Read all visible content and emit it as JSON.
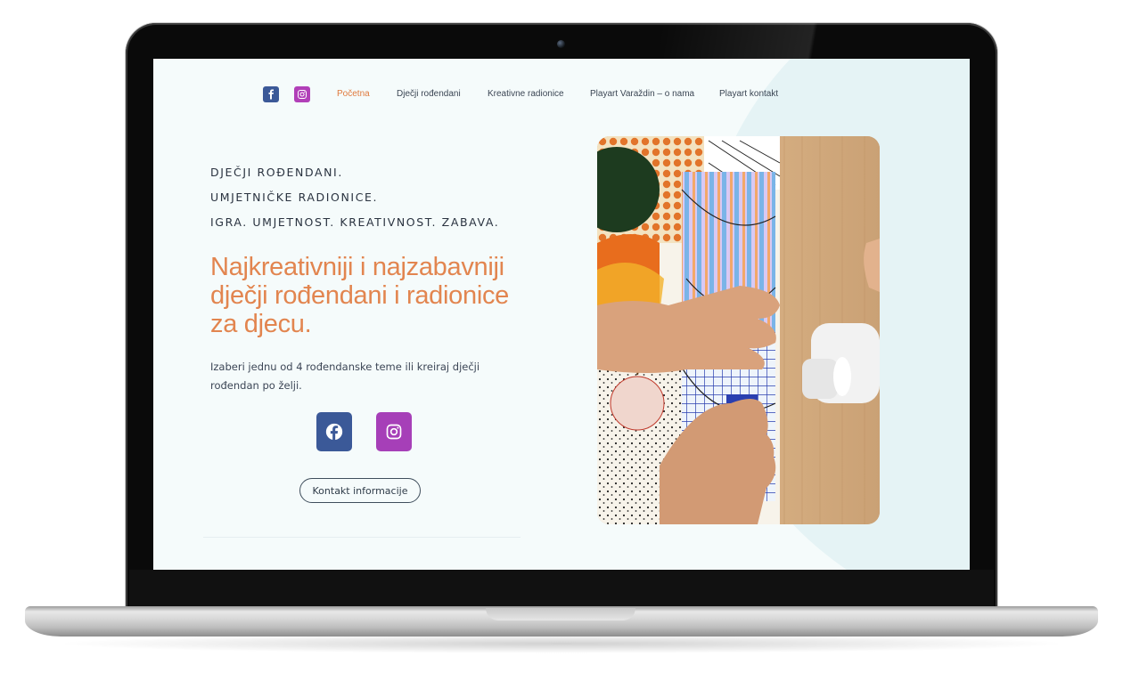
{
  "nav": {
    "items": [
      {
        "label": "Početna",
        "active": true
      },
      {
        "label": "Dječji rođendani",
        "active": false
      },
      {
        "label": "Kreativne radionice",
        "active": false
      },
      {
        "label": "Playart Varaždin – o nama",
        "active": false
      },
      {
        "label": "Playart kontakt",
        "active": false
      }
    ],
    "social_icons": [
      "facebook-icon",
      "instagram-icon"
    ]
  },
  "hero": {
    "taglines": [
      "DJEČJI ROĐENDANI.",
      "UMJETNIČKE RADIONICE.",
      "IGRA. UMJETNOST. KREATIVNOST. ZABAVA."
    ],
    "headline": "Najkreativniji i najzabavniji dječji rođendani i radionice za djecu.",
    "lead": "Izaberi jednu od 4 rođendanske teme ili kreiraj dječji rođendan po želji.",
    "social_buttons": [
      "facebook-icon",
      "instagram-icon"
    ],
    "cta_label": "Kontakt informacije"
  },
  "colors": {
    "accent_orange": "#e2854f",
    "facebook": "#3b5998",
    "instagram": "#a63fb8",
    "page_bg": "#f5fbfb",
    "text_dark": "#2a3340"
  }
}
